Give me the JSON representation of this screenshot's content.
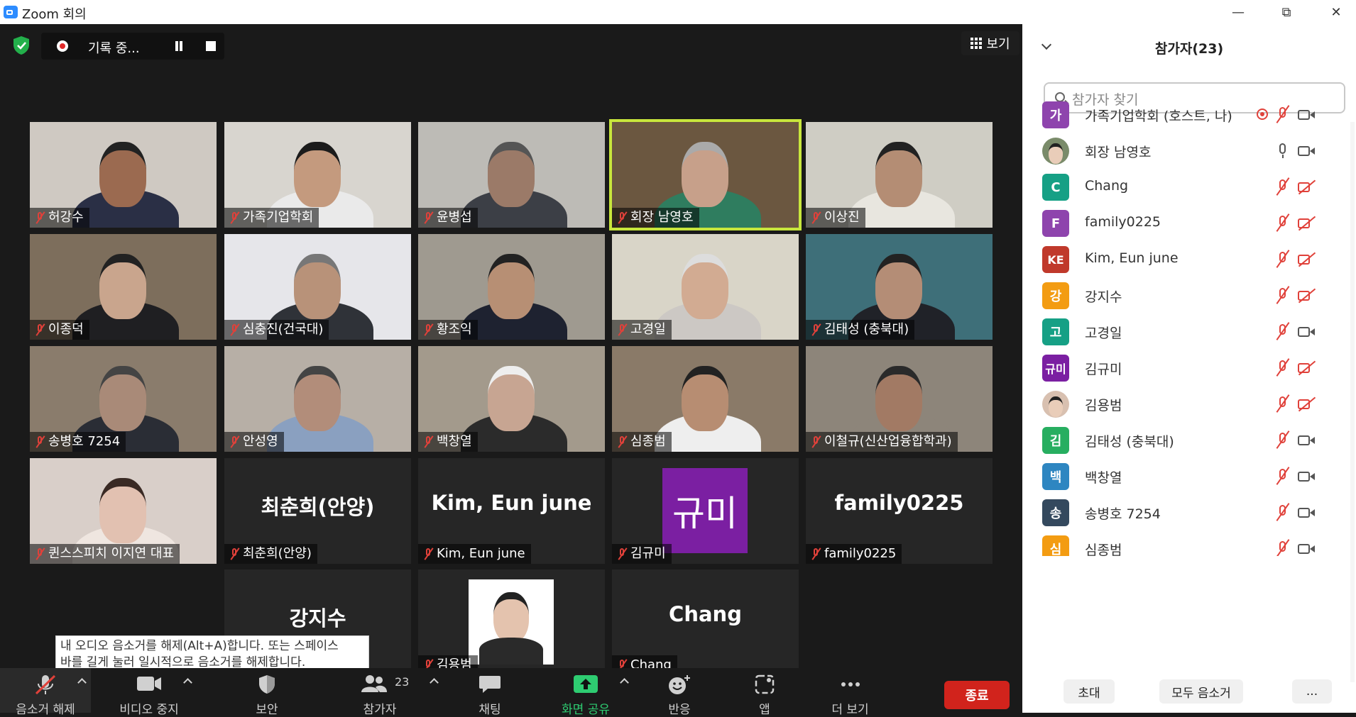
{
  "window": {
    "title": "Zoom 회의"
  },
  "recording": {
    "label": "기록 중..."
  },
  "view": {
    "label": "보기"
  },
  "tiles": [
    {
      "name": "허강수",
      "video": true,
      "bg": "#cfc9c2",
      "skin": "#9b6a50",
      "shirt": "#2a2f45",
      "hair": "#222"
    },
    {
      "name": "가족기업학회",
      "video": true,
      "bg": "#d8d5cf",
      "skin": "#c49a7e",
      "shirt": "#eaeaea",
      "hair": "#1b1b1b"
    },
    {
      "name": "윤병섭",
      "video": true,
      "bg": "#bdbbb6",
      "skin": "#9b7a68",
      "shirt": "#3c3f46",
      "hair": "#555"
    },
    {
      "name": "회장 남영호",
      "video": true,
      "active": true,
      "bg": "#6b5740",
      "skin": "#c7a08a",
      "shirt": "#2f7d5f",
      "hair": "#aaa"
    },
    {
      "name": "이상진",
      "video": true,
      "bg": "#cfcdc4",
      "skin": "#b48d74",
      "shirt": "#e8e6df",
      "hair": "#222"
    },
    {
      "name": "이종덕",
      "video": true,
      "bg": "#7d6e5c",
      "skin": "#c9a58d",
      "shirt": "#1f1f22",
      "hair": "#222"
    },
    {
      "name": "심충진(건국대)",
      "video": true,
      "bg": "#e6e6ea",
      "skin": "#b89279",
      "shirt": "#2f3238",
      "hair": "#777"
    },
    {
      "name": "황조익",
      "video": true,
      "bg": "#9f9a90",
      "skin": "#b78f74",
      "shirt": "#1e2230",
      "hair": "#222"
    },
    {
      "name": "고경일",
      "video": true,
      "bg": "#d9d5c8",
      "skin": "#d2ab92",
      "shirt": "#ccc8c4",
      "hair": "#ddd"
    },
    {
      "name": "김태성 (충북대)",
      "video": true,
      "bg": "#3e6f79",
      "skin": "#b48d76",
      "shirt": "#202228",
      "hair": "#222"
    },
    {
      "name": "송병호 7254",
      "video": true,
      "bg": "#8a7c6c",
      "skin": "#a98a78",
      "shirt": "#2a2d35",
      "hair": "#444"
    },
    {
      "name": "안성영",
      "video": true,
      "bg": "#b7afa6",
      "skin": "#b28d7a",
      "shirt": "#8aa0c0",
      "hair": "#444"
    },
    {
      "name": "백창열",
      "video": true,
      "bg": "#a39a8c",
      "skin": "#c7a592",
      "shirt": "#2b2b2b",
      "hair": "#eee"
    },
    {
      "name": "심종범",
      "video": true,
      "bg": "#8a7a68",
      "skin": "#b78d72",
      "shirt": "#eee",
      "hair": "#222"
    },
    {
      "name": "이철규(신산업융합학과)",
      "video": true,
      "bg": "#8d857a",
      "skin": "#a27a64",
      "shirt": "#8d857a",
      "hair": "#2a2a2a"
    },
    {
      "name": "퀸스스피치 이지연 대표",
      "video": true,
      "bg": "#d9cfc9",
      "skin": "#e2c1b1",
      "shirt": "#efe6e0",
      "hair": "#3a2a24"
    },
    {
      "name": "최춘희(안양)",
      "video": false,
      "display": "최춘희(안양)"
    },
    {
      "name": "Kim, Eun june",
      "video": false,
      "display": "Kim, Eun june"
    },
    {
      "name": "김규미",
      "video": false,
      "kyumi": "규미"
    },
    {
      "name": "family0225",
      "video": false,
      "display": "family0225"
    },
    {
      "name": "강지수",
      "video": false,
      "display": "강지수"
    },
    {
      "name": "김용범",
      "video": false,
      "photo": true
    },
    {
      "name": "Chang",
      "video": false,
      "display": "Chang"
    }
  ],
  "tooltip": {
    "line1": "내 오디오 음소거를 해제(Alt+A)합니다. 또는 스페이스",
    "line2": "바를 길게 눌러 일시적으로 음소거를 해제합니다."
  },
  "toolbar": {
    "unmute": "음소거 해제",
    "video": "비디오 중지",
    "security": "보안",
    "participants": "참가자",
    "participants_count": "23",
    "chat": "채팅",
    "share": "화면 공유",
    "reactions": "반응",
    "apps": "앱",
    "more": "더 보기",
    "end": "종료"
  },
  "panel": {
    "title": "참가자(23)",
    "search_placeholder": "참가자 찾기",
    "invite": "초대",
    "mute_all": "모두 음소거",
    "more": "...",
    "participants": [
      {
        "initials": "가",
        "color": "#8e44ad",
        "name": "가족기업학회 (호스트, 나)",
        "rec": true,
        "audio": "muted",
        "video": "on"
      },
      {
        "initials": "",
        "color": "#7a8b6a",
        "photo": true,
        "name": "회장 남영호",
        "audio": "on",
        "video": "on"
      },
      {
        "initials": "C",
        "color": "#16a085",
        "name": "Chang",
        "audio": "muted",
        "video": "off"
      },
      {
        "initials": "F",
        "color": "#8e44ad",
        "name": "family0225",
        "audio": "muted",
        "video": "off"
      },
      {
        "initials": "KE",
        "color": "#c0392b",
        "name": "Kim, Eun june",
        "audio": "muted",
        "video": "off"
      },
      {
        "initials": "강",
        "color": "#f39c12",
        "name": "강지수",
        "audio": "muted",
        "video": "off"
      },
      {
        "initials": "고",
        "color": "#16a085",
        "name": "고경일",
        "audio": "muted",
        "video": "on"
      },
      {
        "initials": "규미",
        "color": "#7b1fa2",
        "name": "김규미",
        "audio": "muted",
        "video": "off"
      },
      {
        "initials": "",
        "color": "#d8c0b0",
        "photo": true,
        "name": "김용범",
        "audio": "muted",
        "video": "off"
      },
      {
        "initials": "김",
        "color": "#27ae60",
        "name": "김태성 (충북대)",
        "audio": "muted",
        "video": "on"
      },
      {
        "initials": "백",
        "color": "#2e86c1",
        "name": "백창열",
        "audio": "muted",
        "video": "on"
      },
      {
        "initials": "송",
        "color": "#34495e",
        "name": "송병호 7254",
        "audio": "muted",
        "video": "on"
      },
      {
        "initials": "심",
        "color": "#f39c12",
        "name": "심종범",
        "audio": "muted",
        "video": "on"
      }
    ]
  }
}
